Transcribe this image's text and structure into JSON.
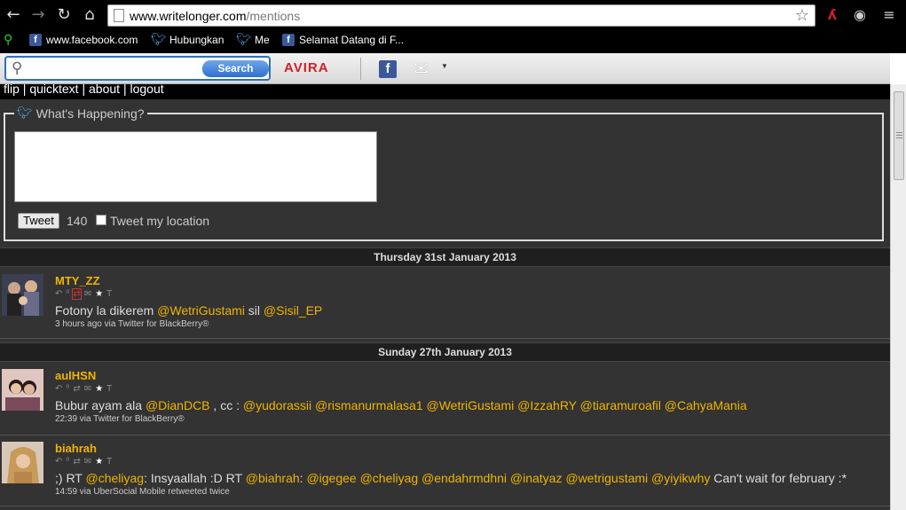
{
  "browser": {
    "url_domain": "www.writelonger.com",
    "url_path": "/mentions",
    "bookmarks": [
      {
        "label": "www.facebook.com",
        "icon": "facebook-icon"
      },
      {
        "label": "Hubungkan",
        "icon": "twitter-icon"
      },
      {
        "label": "Me",
        "icon": "twitter-icon"
      },
      {
        "label": "Selamat Datang di F...",
        "icon": "facebook-icon"
      }
    ]
  },
  "extension_toolbar": {
    "search_label": "Search",
    "search_placeholder": "",
    "avira_label": "AVIRA"
  },
  "nav": {
    "links": [
      "flip",
      "quicktext",
      "about",
      "logout"
    ]
  },
  "compose": {
    "legend": "What's Happening?",
    "tweet_label": "Tweet",
    "counter": "140",
    "location_label": "Tweet my location"
  },
  "timeline": {
    "days": [
      {
        "date": "Thursday 31st January 2013",
        "tweets": [
          {
            "user": "MTY_ZZ",
            "parts": [
              {
                "t": "Fotony la dikerem "
              },
              {
                "m": "@WetriGustami"
              },
              {
                "t": " sil "
              },
              {
                "m": "@Sisil_EP"
              }
            ],
            "meta": "3 hours ago via Twitter for BlackBerry®"
          }
        ]
      },
      {
        "date": "Sunday 27th January 2013",
        "tweets": [
          {
            "user": "aulHSN",
            "parts": [
              {
                "t": "Bubur ayam ala "
              },
              {
                "m": "@DianDCB"
              },
              {
                "t": " , cc : "
              },
              {
                "m": "@yudorassii"
              },
              {
                "t": " "
              },
              {
                "m": "@rismanurmalasa1"
              },
              {
                "t": " "
              },
              {
                "m": "@WetriGustami"
              },
              {
                "t": " "
              },
              {
                "m": "@IzzahRY"
              },
              {
                "t": " "
              },
              {
                "m": "@tiaramuroafil"
              },
              {
                "t": " "
              },
              {
                "m": "@CahyaMania"
              }
            ],
            "meta": "22:39 via Twitter for BlackBerry®"
          },
          {
            "user": "biahrah",
            "parts": [
              {
                "t": ";) RT "
              },
              {
                "m": "@cheliyag"
              },
              {
                "t": ": Insyaallah :D RT "
              },
              {
                "m": "@biahrah"
              },
              {
                "t": ": "
              },
              {
                "m": "@igegee"
              },
              {
                "t": " "
              },
              {
                "m": "@cheliyag"
              },
              {
                "t": " "
              },
              {
                "m": "@endahrmdhni"
              },
              {
                "t": " "
              },
              {
                "m": "@inatyaz"
              },
              {
                "t": " "
              },
              {
                "m": "@wetrigustami"
              },
              {
                "t": " "
              },
              {
                "m": "@yiyikwhy"
              },
              {
                "t": " Can't wait for february :*"
              }
            ],
            "meta": "14:59 via UberSocial Mobile retweeted twice"
          }
        ]
      }
    ]
  }
}
